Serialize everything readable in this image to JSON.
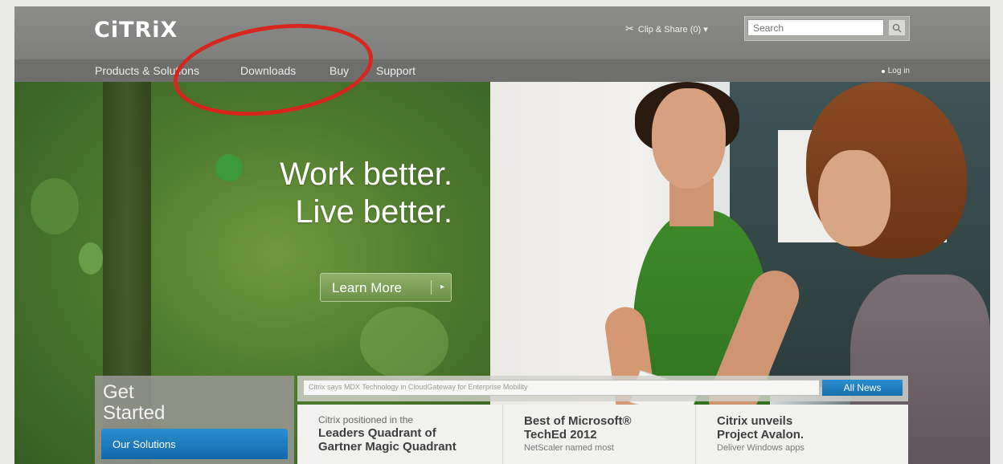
{
  "header": {
    "logo": "CiTRiX",
    "clip_share": "Clip & Share (0) ▾",
    "search_placeholder": "Search",
    "login": "Log in"
  },
  "nav": {
    "items": [
      "Products & Solutions",
      "Downloads",
      "Buy",
      "Support"
    ]
  },
  "hero": {
    "line1": "Work better.",
    "line2": "Live better.",
    "cta_label": "Learn More",
    "cta_arrow": "▸"
  },
  "get_started": {
    "title_line1": "Get",
    "title_line2": "Started",
    "button_label": "Our Solutions"
  },
  "news": {
    "ticker": "Citrix says MDX Technology in CloudGateway for Enterprise Mobility",
    "all_news_label": "All News",
    "cards": [
      {
        "pre": "Citrix positioned in the",
        "title_line1": "Leaders Quadrant of",
        "title_line2": "Gartner Magic Quadrant",
        "sub": ""
      },
      {
        "pre": "",
        "title_line1": "Best of Microsoft®",
        "title_line2": "TechEd 2012",
        "sub": "NetScaler named most"
      },
      {
        "pre": "",
        "title_line1": "Citrix unveils",
        "title_line2": "Project Avalon.",
        "sub": "Deliver Windows apps"
      }
    ]
  },
  "colors": {
    "topbar": "#858583",
    "navbar": "#6e6e6c",
    "hero_green": "#4e7a2e",
    "annotation_red": "#d8261f",
    "accent_blue": "#1b75bc"
  }
}
